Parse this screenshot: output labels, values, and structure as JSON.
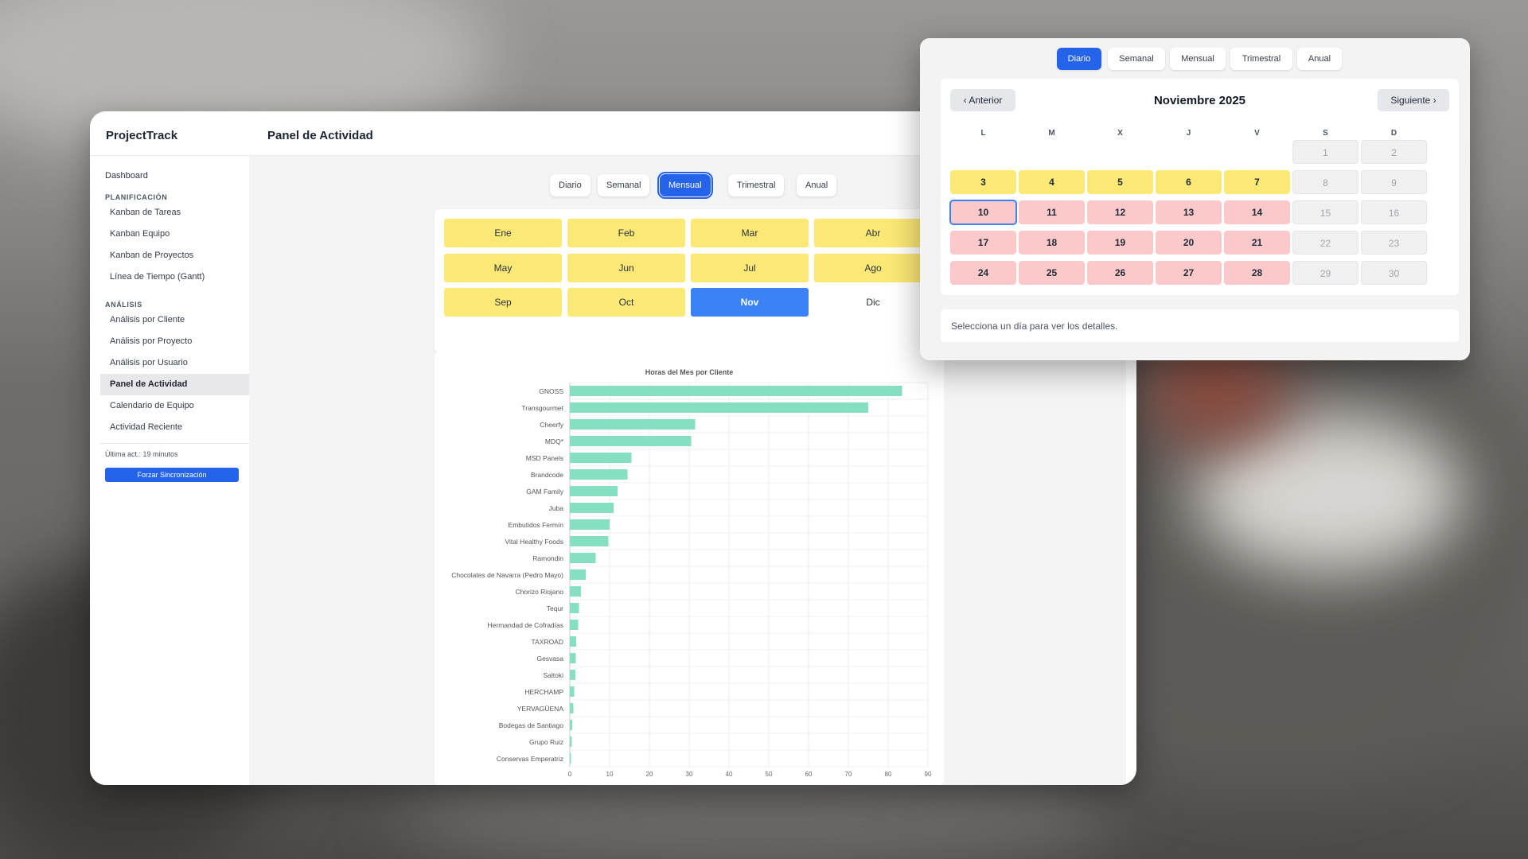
{
  "app": {
    "brand": "ProjectTrack",
    "page_title": "Panel de Actividad"
  },
  "sidebar": {
    "dashboard": "Dashboard",
    "sections": [
      {
        "title": "PLANIFICACIÓN",
        "items": [
          "Kanban de Tareas",
          "Kanban Equipo",
          "Kanban de Proyectos",
          "Línea de Tiempo (Gantt)"
        ]
      },
      {
        "title": "ANÁLISIS",
        "items": [
          "Análisis por Cliente",
          "Análisis por Proyecto",
          "Análisis por Usuario",
          "Panel de Actividad",
          "Calendario de Equipo",
          "Actividad Reciente"
        ]
      }
    ],
    "active_item": "Panel de Actividad",
    "last_update": "Última act.: 19 minutos",
    "sync_button": "Forzar Sincronización"
  },
  "period_tabs": {
    "items": [
      "Diario",
      "Semanal",
      "Mensual",
      "Trimestral",
      "Anual"
    ],
    "active": "Mensual"
  },
  "months": {
    "items": [
      "Ene",
      "Feb",
      "Mar",
      "Abr",
      "May",
      "Jun",
      "Jul",
      "Ago",
      "Sep",
      "Oct",
      "Nov",
      "Dic"
    ],
    "active": "Nov",
    "colors": {
      "highlight": "#fbe875",
      "active": "#3b82f6"
    }
  },
  "chart_data": {
    "type": "bar",
    "orientation": "horizontal",
    "title": "Horas del Mes por Cliente",
    "categories": [
      "GNOSS",
      "Transgourmet",
      "Cheerfy",
      "MDQ*",
      "MSD Panels",
      "Brandcode",
      "GAM Family",
      "Juba",
      "Embutidos Fermín",
      "Vital Healthy Foods",
      "Ramondin",
      "Chocolates de Navarra (Pedro Mayo)",
      "Chorizo Riojano",
      "Tequr",
      "Hermandad de Cofradías",
      "TAXROAD",
      "Gesvasa",
      "Saltoki",
      "HERCHAMP",
      "YERVAGÜENA",
      "Bodegas de Santiago",
      "Grupo Ruiz",
      "Conservas Emperatriz"
    ],
    "values": [
      83.5,
      75,
      31.5,
      30.5,
      15.5,
      14.5,
      12,
      11,
      10,
      9.7,
      6.5,
      4,
      2.8,
      2.3,
      2.1,
      1.6,
      1.5,
      1.4,
      1.1,
      0.9,
      0.6,
      0.5,
      0.3
    ],
    "xlim": [
      0,
      90
    ],
    "x_ticks": [
      0,
      10,
      20,
      30,
      40,
      50,
      60,
      70,
      80,
      90
    ],
    "bar_color": "#86dfc0",
    "grid": true
  },
  "calendar": {
    "tabs": [
      "Diario",
      "Semanal",
      "Mensual",
      "Trimestral",
      "Anual"
    ],
    "active_tab": "Diario",
    "prev": "‹ Anterior",
    "next": "Siguiente ›",
    "month_label": "Noviembre 2025",
    "weekdays": [
      "L",
      "M",
      "X",
      "J",
      "V",
      "S",
      "D"
    ],
    "days": [
      {
        "d": "1",
        "s": "g"
      },
      {
        "d": "2",
        "s": "g"
      },
      {
        "d": "3",
        "s": "y"
      },
      {
        "d": "4",
        "s": "y"
      },
      {
        "d": "5",
        "s": "y"
      },
      {
        "d": "6",
        "s": "y"
      },
      {
        "d": "7",
        "s": "y"
      },
      {
        "d": "8",
        "s": "g"
      },
      {
        "d": "9",
        "s": "g"
      },
      {
        "d": "10",
        "s": "p",
        "selected": true
      },
      {
        "d": "11",
        "s": "p"
      },
      {
        "d": "12",
        "s": "p"
      },
      {
        "d": "13",
        "s": "p"
      },
      {
        "d": "14",
        "s": "p"
      },
      {
        "d": "15",
        "s": "g"
      },
      {
        "d": "16",
        "s": "g"
      },
      {
        "d": "17",
        "s": "p"
      },
      {
        "d": "18",
        "s": "p"
      },
      {
        "d": "19",
        "s": "p"
      },
      {
        "d": "20",
        "s": "p"
      },
      {
        "d": "21",
        "s": "p"
      },
      {
        "d": "22",
        "s": "g"
      },
      {
        "d": "23",
        "s": "g"
      },
      {
        "d": "24",
        "s": "p"
      },
      {
        "d": "25",
        "s": "p"
      },
      {
        "d": "26",
        "s": "p"
      },
      {
        "d": "27",
        "s": "p"
      },
      {
        "d": "28",
        "s": "p"
      },
      {
        "d": "29",
        "s": "g"
      },
      {
        "d": "30",
        "s": "g"
      }
    ],
    "hint": "Selecciona un día para ver los detalles."
  }
}
